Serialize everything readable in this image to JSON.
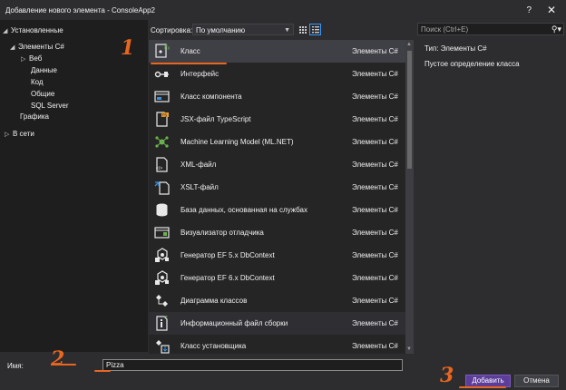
{
  "window": {
    "title": "Добавление нового элемента - ConsoleApp2",
    "help": "?",
    "close": "✕"
  },
  "tree": {
    "installed": "Установленные",
    "csharp_items": "Элементы C#",
    "web": "Веб",
    "data": "Данные",
    "code": "Код",
    "general": "Общие",
    "sql_server": "SQL Server",
    "graphics": "Графика",
    "online": "В сети"
  },
  "toolbar": {
    "sort_label": "Сортировка:",
    "sort_value": "По умолчанию"
  },
  "items": [
    {
      "name": "Класс",
      "category": "Элементы C#",
      "icon": "class-icon"
    },
    {
      "name": "Интерфейс",
      "category": "Элементы C#",
      "icon": "interface-icon"
    },
    {
      "name": "Класс компонента",
      "category": "Элементы C#",
      "icon": "component-class-icon"
    },
    {
      "name": "JSX-файл TypeScript",
      "category": "Элементы C#",
      "icon": "tsx-file-icon"
    },
    {
      "name": "Machine Learning Model (ML.NET)",
      "category": "Элементы C#",
      "icon": "ml-model-icon"
    },
    {
      "name": "XML-файл",
      "category": "Элементы C#",
      "icon": "xml-file-icon"
    },
    {
      "name": "XSLT-файл",
      "category": "Элементы C#",
      "icon": "xslt-file-icon"
    },
    {
      "name": "База данных, основанная на службах",
      "category": "Элементы C#",
      "icon": "database-icon"
    },
    {
      "name": "Визуализатор отладчика",
      "category": "Элементы C#",
      "icon": "debugger-visualizer-icon"
    },
    {
      "name": "Генератор EF 5.x DbContext",
      "category": "Элементы C#",
      "icon": "ef-generator-icon"
    },
    {
      "name": "Генератор EF 6.x DbContext",
      "category": "Элементы C#",
      "icon": "ef-generator-icon"
    },
    {
      "name": "Диаграмма классов",
      "category": "Элементы C#",
      "icon": "class-diagram-icon"
    },
    {
      "name": "Информационный файл сборки",
      "category": "Элементы C#",
      "icon": "assembly-info-icon"
    },
    {
      "name": "Класс установщика",
      "category": "Элементы C#",
      "icon": "installer-class-icon"
    }
  ],
  "search": {
    "placeholder": "Поиск (Ctrl+E)"
  },
  "details": {
    "type": "Тип:  Элементы C#",
    "description": "Пустое определение класса"
  },
  "footer": {
    "name_label": "Имя:",
    "name_value": "Pizza",
    "add": "Добавить",
    "cancel": "Отмена"
  },
  "annotations": {
    "one": "1",
    "two": "2",
    "three": "3"
  },
  "colors": {
    "accent": "#5c3d99",
    "annotation": "#e8661f",
    "icon_green": "#6ab04c",
    "icon_white": "#e8e8e8"
  }
}
